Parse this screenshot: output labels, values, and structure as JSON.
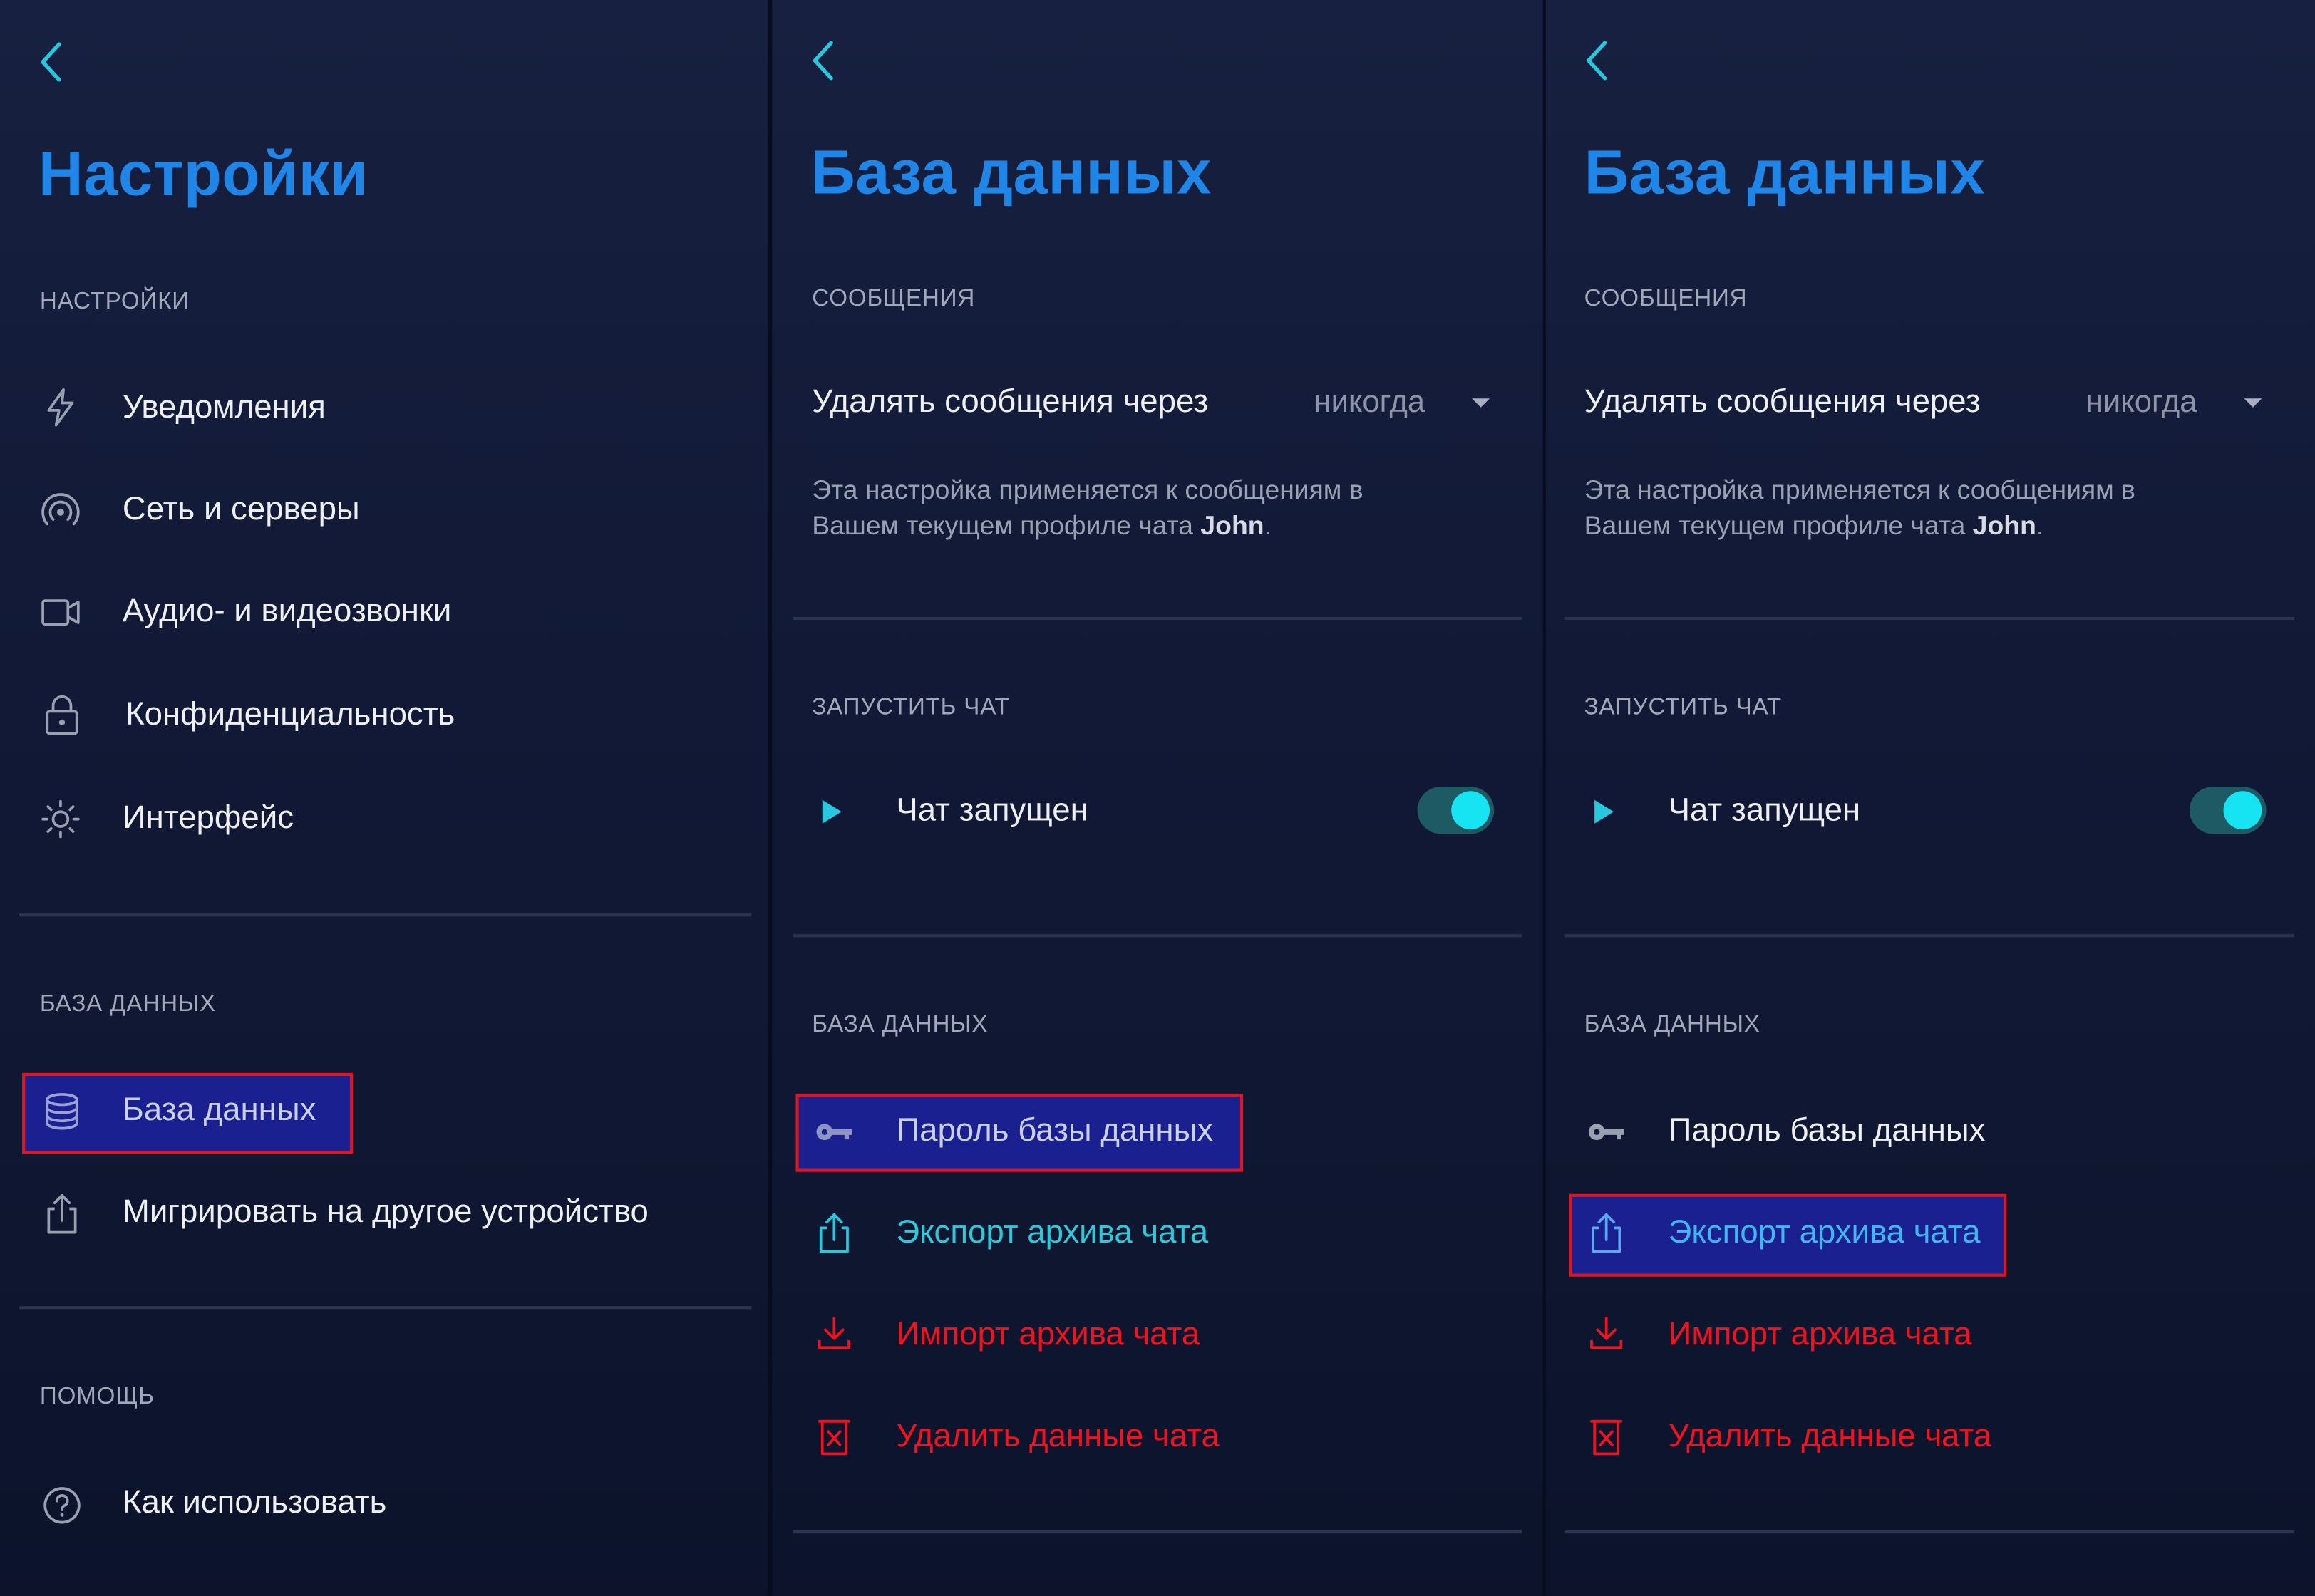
{
  "colors": {
    "title_blue": "#1f85e6",
    "accent_cyan": "#2ec9d9",
    "danger_red": "#f2121d",
    "highlight_fill": "#1b2090",
    "highlight_border": "#e0151f"
  },
  "panel1": {
    "title": "Настройки",
    "section_settings": "НАСТРОЙКИ",
    "items": [
      {
        "label": "Уведомления",
        "icon": "lightning-icon"
      },
      {
        "label": "Сеть и серверы",
        "icon": "network-icon"
      },
      {
        "label": "Аудио- и видеозвонки",
        "icon": "video-call-icon"
      },
      {
        "label": "Конфиденциальность",
        "icon": "lock-icon"
      },
      {
        "label": "Интерфейс",
        "icon": "sun-icon"
      }
    ],
    "section_database": "БАЗА ДАННЫХ",
    "database_item": {
      "label": "База данных",
      "icon": "database-icon"
    },
    "migrate_item": {
      "label": "Мигрировать на другое устройство",
      "icon": "share-icon"
    },
    "section_help": "ПОМОЩЬ",
    "help_item": {
      "label": "Как использовать",
      "icon": "question-icon"
    }
  },
  "panel2": {
    "title": "База данных",
    "section_messages": "СООБЩЕНИЯ",
    "delete_messages_label": "Удалять сообщения через",
    "delete_messages_value": "никогда",
    "description_line1": "Эта настройка применяется к сообщениям в",
    "description_line2": "Вашем текущем профиле чата",
    "description_name": "John",
    "description_end": ".",
    "section_run_chat": "ЗАПУСТИТЬ ЧАТ",
    "chat_running_label": "Чат запущен",
    "chat_running": true,
    "section_database": "БАЗА ДАННЫХ",
    "password_label": "Пароль базы данных",
    "export_label": "Экспорт архива чата",
    "import_label": "Импорт архива чата",
    "delete_label": "Удалить данные чата"
  },
  "panel3": {
    "title": "База данных",
    "section_messages": "СООБЩЕНИЯ",
    "delete_messages_label": "Удалять сообщения через",
    "delete_messages_value": "никогда",
    "description_line1": "Эта настройка применяется к сообщениям в",
    "description_line2": "Вашем текущем профиле чата",
    "description_name": "John",
    "description_end": ".",
    "section_run_chat": "ЗАПУСТИТЬ ЧАТ",
    "chat_running_label": "Чат запущен",
    "chat_running": true,
    "section_database": "БАЗА ДАННЫХ",
    "password_label": "Пароль базы данных",
    "export_label": "Экспорт архива чата",
    "import_label": "Импорт архива чата",
    "delete_label": "Удалить данные чата"
  }
}
